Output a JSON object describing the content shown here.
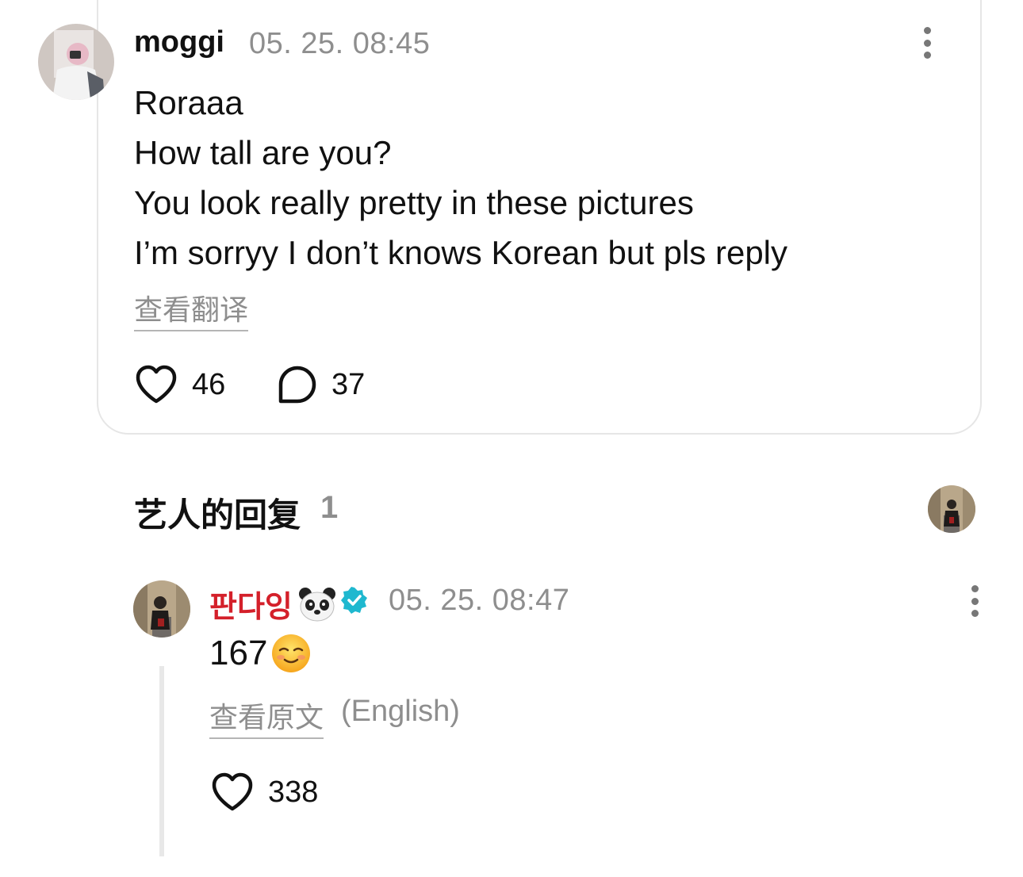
{
  "comment": {
    "username": "moggi",
    "timestamp": "05. 25. 08:45",
    "lines": [
      "Roraaa",
      "How tall are you?",
      "You look really pretty in these pictures",
      "I’m sorryy I don’t knows Korean but pls reply"
    ],
    "translate_link": "查看翻译",
    "likes": "46",
    "comments": "37"
  },
  "artist_replies": {
    "title": "艺人的回复",
    "count": "1"
  },
  "reply": {
    "username": "판다잉",
    "timestamp": "05. 25. 08:47",
    "text": "167",
    "original_link": "查看原文",
    "original_lang": "(English)",
    "likes": "338"
  },
  "colors": {
    "artist_name": "#d4202a",
    "verified_badge": "#1fb8cf",
    "muted_text": "#8e8e8e"
  },
  "icons": [
    "heart-icon",
    "comment-icon",
    "more-icon",
    "verified-icon",
    "panda-emoji",
    "smiling-emoji"
  ]
}
